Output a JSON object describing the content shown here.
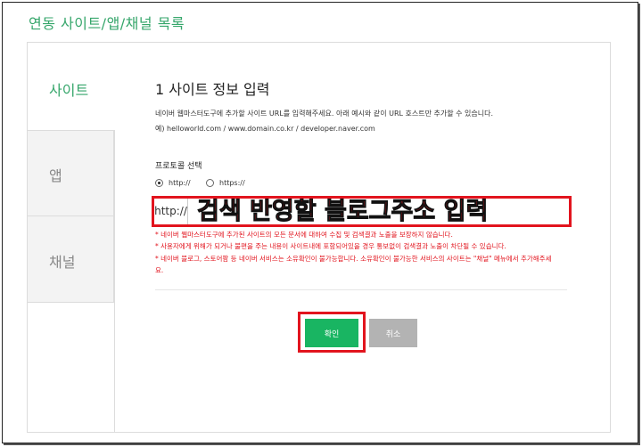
{
  "page": {
    "title": "연동 사이트/앱/채널 목록"
  },
  "tabs": [
    {
      "label": "사이트"
    },
    {
      "label": "앱"
    },
    {
      "label": "채널"
    }
  ],
  "section": {
    "title": "1 사이트 정보 입력",
    "desc_line1": "네이버 웹마스터도구에 추가할 사이트 URL를 입력해주세요. 아래 예시와 같이 URL 호스트만 추가할 수 있습니다.",
    "desc_line2": "예) helloworld.com / www.domain.co.kr / developer.naver.com"
  },
  "protocol": {
    "label": "프로토콜 선택",
    "options": [
      {
        "label": "http://",
        "selected": true
      },
      {
        "label": "https://",
        "selected": false
      }
    ]
  },
  "url_field": {
    "prefix": "http://",
    "placeholder": "검색 반영할 블로그주소 입력"
  },
  "notices": [
    "* 네이버 웹마스터도구에 추가된 사이트의 모든 문서에 대하여 수집 및 검색결과 노출을 보장하지 않습니다.",
    "* 사용자에게 위해가 되거나 불편을 주는 내용이 사이트내에 포함되어있을 경우 통보없이 검색결과 노출이 차단될 수 있습니다.",
    "* 네이버 블로그, 스토어팜 등 네이버 서비스는 소유확인이 불가능합니다. 소유확인이 불가능한 서비스의 사이트는 \"채널\" 메뉴에서 추가해주세",
    "요."
  ],
  "buttons": {
    "confirm": "확인",
    "cancel": "취소"
  },
  "colors": {
    "accent": "#36a66b",
    "confirm": "#19b562",
    "highlight": "#e2141e",
    "cancel": "#b3b3b3"
  }
}
